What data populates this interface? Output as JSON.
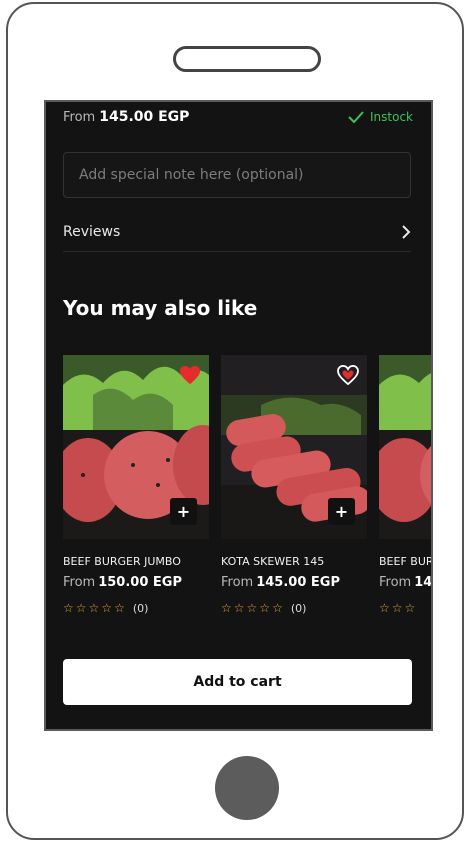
{
  "product": {
    "price_prefix": "From",
    "price": "145.00 EGP",
    "stock_status": "Instock"
  },
  "note_placeholder": "Add special note here (optional)",
  "reviews": {
    "label": "Reviews"
  },
  "recommendations": {
    "title": "You may also like",
    "items": [
      {
        "name": "BEEF BURGER JUMBO",
        "price_prefix": "From",
        "price": "150.00 EGP",
        "rating_count": "(0)",
        "add_label": "+",
        "favorited": true
      },
      {
        "name": "KOTA SKEWER 145",
        "price_prefix": "From",
        "price": "145.00 EGP",
        "rating_count": "(0)",
        "add_label": "+",
        "favorited": false
      },
      {
        "name": "BEEF BUR",
        "price_prefix": "From",
        "price": "14",
        "rating_count": "",
        "add_label": "+",
        "favorited": false
      }
    ]
  },
  "add_to_cart_label": "Add to cart",
  "colors": {
    "accent_green": "#3ec15a",
    "star": "#e0a93a",
    "heart_red": "#e52b2b",
    "background": "#131313"
  }
}
